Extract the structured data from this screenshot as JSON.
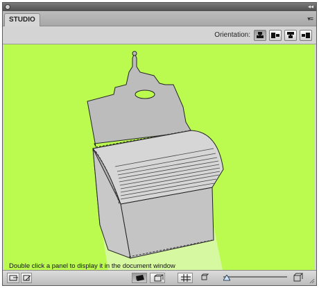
{
  "window": {
    "collapse_glyph": "◂◂"
  },
  "tab": {
    "label": "STUDIO"
  },
  "panel_menu": {
    "icon": "panel-menu-icon",
    "glyph": "▾≡"
  },
  "orientation": {
    "label": "Orientation:",
    "selected": "portrait",
    "buttons": [
      {
        "name": "portrait",
        "icon": "orientation-portrait-icon"
      },
      {
        "name": "landscape-left",
        "icon": "orientation-landscape-left-icon"
      },
      {
        "name": "portrait-flipped",
        "icon": "orientation-upside-down-icon"
      },
      {
        "name": "landscape-right",
        "icon": "orientation-landscape-right-icon"
      }
    ]
  },
  "viewport": {
    "background": "#bbfb4f",
    "hint": "Double click a panel to display it in the document window",
    "model_color": "#bcbcbc",
    "slat_color": "#d6d6d6"
  },
  "statusbar": {
    "tools": [
      "fit-view-icon",
      "edit-icon",
      "shaded-view-icon",
      "box-view-icon",
      "grid-icon",
      "zoom-out-icon",
      "zoom-in-icon"
    ],
    "zoom_level": 0.0
  }
}
